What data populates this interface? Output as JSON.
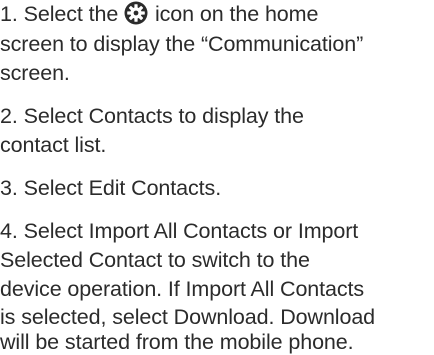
{
  "steps": [
    {
      "lines": [
        {
          "before": "1.  Select the ",
          "icon": "gear-icon",
          "after": " icon on the home"
        },
        "screen to display the “Communication”",
        "screen."
      ]
    },
    {
      "lines": [
        "2.  Select Contacts to display the",
        "contact list."
      ]
    },
    {
      "lines": [
        "3.  Select Edit Contacts."
      ]
    },
    {
      "lines": [
        "4.  Select Import All Contacts or Import",
        "Selected Contact to switch to the",
        "device operation. If Import All Contacts",
        "is selected, select Download. Download",
        "will be started from the mobile phone."
      ]
    }
  ]
}
